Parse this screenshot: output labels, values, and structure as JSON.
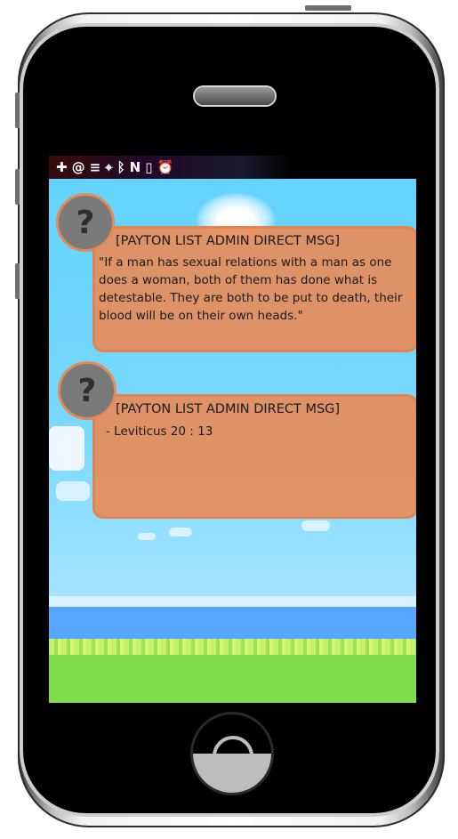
{
  "status_bar": {
    "icons": [
      "medical-cross-icon",
      "at-sign-icon",
      "list-icon",
      "location-pin-icon",
      "bluetooth-icon",
      "nfc-icon",
      "phone-vibrate-icon",
      "alarm-clock-icon"
    ],
    "glyphs": [
      "✚",
      "@",
      "≡",
      "⌖",
      "ᛒ",
      "N",
      "▯",
      "⏰"
    ]
  },
  "messages": [
    {
      "sender": "[PAYTON LIST ADMIN DIRECT MSG]",
      "avatar_glyph": "?",
      "text": "\"If a man has sexual relations with a man as one does a woman, both of them has done what is detestable. They are both to be put to death, their blood will be on their own heads.\""
    },
    {
      "sender": "[PAYTON LIST ADMIN DIRECT MSG]",
      "avatar_glyph": "?",
      "text": "- Leviticus 20 : 13"
    }
  ],
  "colors": {
    "bubble": "#e88c5a",
    "avatar": "#7a7a7a",
    "sky": "#6fd6ff",
    "sea": "#58a6ff",
    "grass": "#7fdc4a"
  }
}
